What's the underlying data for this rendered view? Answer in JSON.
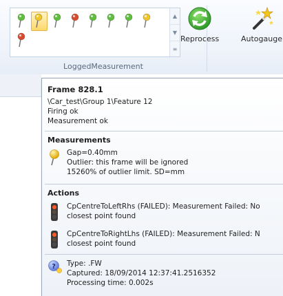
{
  "ribbon": {
    "gallery": {
      "pins": [
        {
          "color": "#5fbf3c",
          "selected": false
        },
        {
          "color": "#f0c52a",
          "selected": true
        },
        {
          "color": "#5fbf3c",
          "selected": false
        },
        {
          "color": "#d84a2b",
          "selected": false
        },
        {
          "color": "#5fbf3c",
          "selected": false
        },
        {
          "color": "#5fbf3c",
          "selected": false
        },
        {
          "color": "#5fbf3c",
          "selected": false
        },
        {
          "color": "#f0c52a",
          "selected": false
        },
        {
          "color": "#d84a2b",
          "selected": false
        }
      ],
      "group_label": "LoggedMeasurement"
    },
    "reprocess_label": "Reprocess",
    "autogauge_label": "Autogauge"
  },
  "tooltip": {
    "title": "Frame 828.1",
    "path": "\\Car_test\\Group 1\\Feature 12",
    "status1": "Firing ok",
    "status2": "Measurement ok",
    "measurements": {
      "heading": "Measurements",
      "gap": "Gap=0.40mm",
      "outlier": "Outlier: this frame will be ignored",
      "limit": "15260% of outlier limit. SD=mm"
    },
    "actions": {
      "heading": "Actions",
      "items": [
        {
          "line1": "CpCentreToLeftRhs (FAILED): Measurement Failed: No",
          "line2": "closest point found"
        },
        {
          "line1": "CpCentreToRightLhs (FAILED): Measurement Failed: N",
          "line2": "closest point found"
        }
      ]
    },
    "info": {
      "type": "Type: .FW",
      "captured": "Captured: 18/09/2014 12:37:41.2516352",
      "processing": "Processing time: 0.002s"
    }
  },
  "colors": {
    "green": "#5fbf3c",
    "yellow": "#f0c52a",
    "red": "#d84a2b"
  }
}
